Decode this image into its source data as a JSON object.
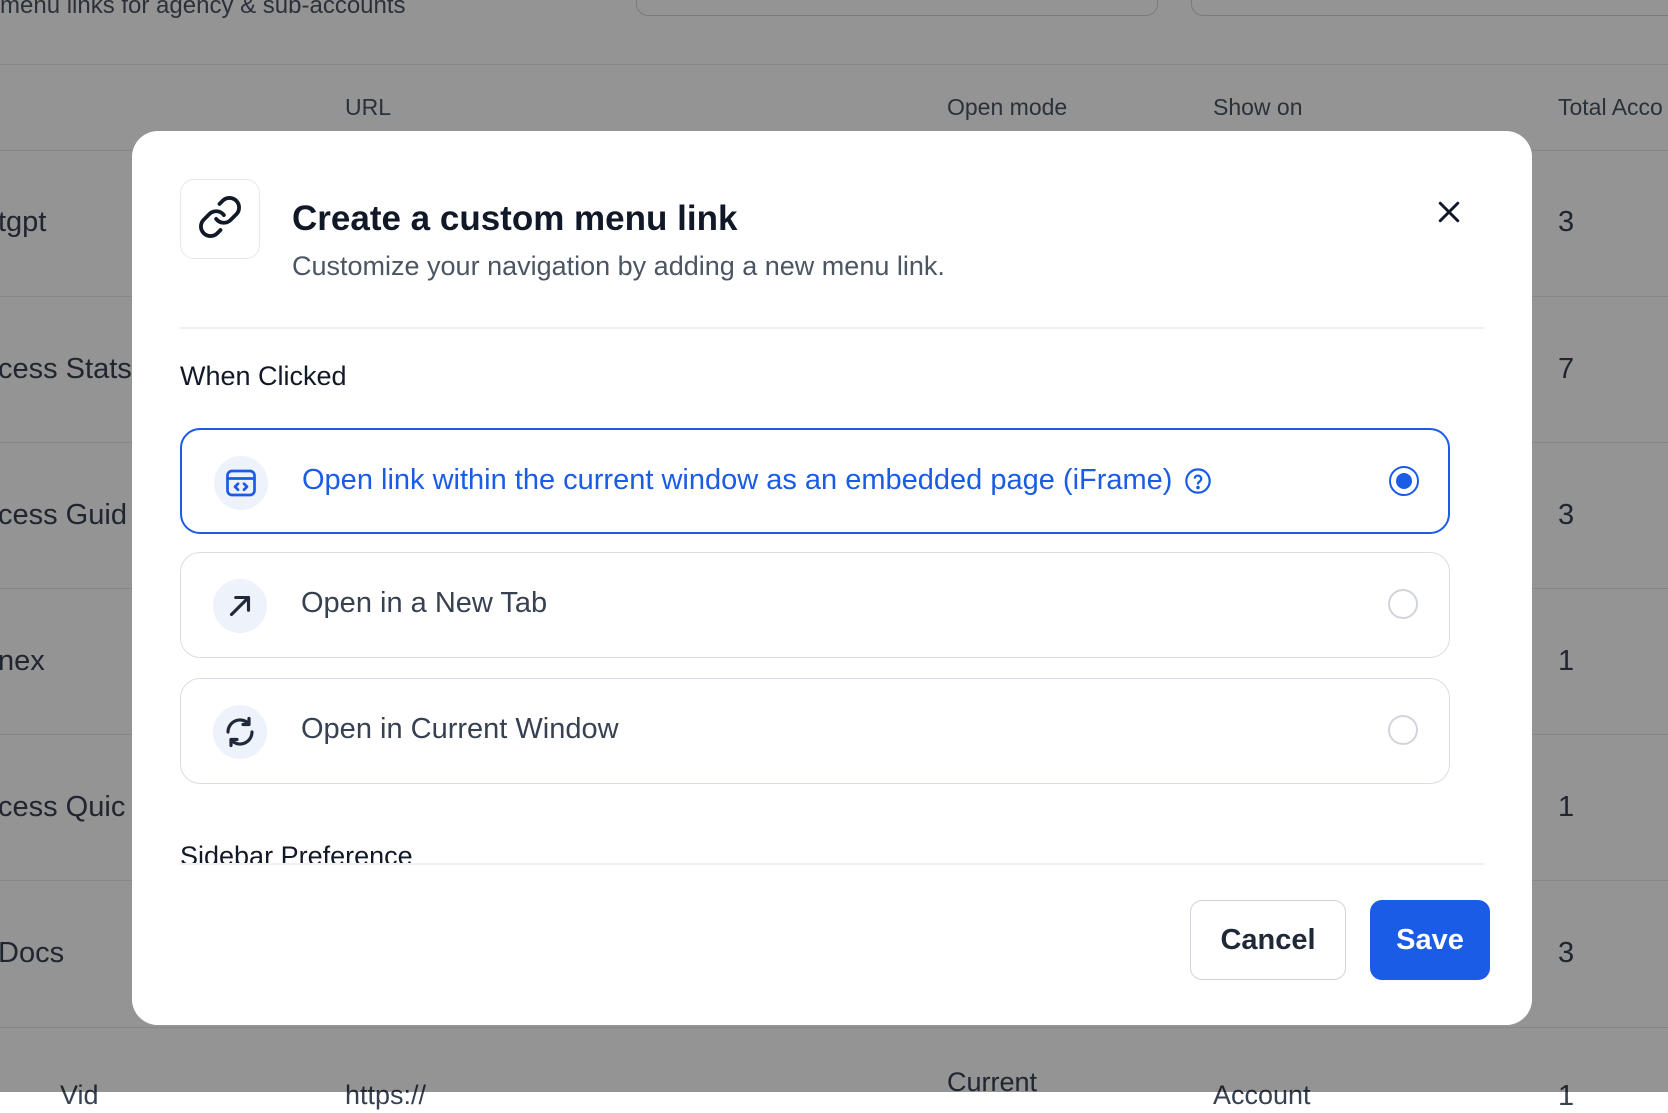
{
  "background": {
    "subtitle": "menu links for agency & sub-accounts",
    "columns": [
      "URL",
      "Open mode",
      "Show on",
      "Total Acco"
    ],
    "rows": [
      {
        "name": "tgpt",
        "count": "3"
      },
      {
        "name": "cess Stats",
        "count": "7"
      },
      {
        "name": "cess Guid",
        "count": "3"
      },
      {
        "name": "nex",
        "count": "1"
      },
      {
        "name": "cess Quic",
        "count": "1"
      },
      {
        "name": "Docs",
        "count": "3"
      }
    ],
    "partial_row": {
      "name": "Vid",
      "url": "https://",
      "open_mode": "Current",
      "show_on": "Account",
      "count": "1"
    }
  },
  "modal": {
    "title": "Create a custom menu link",
    "description": "Customize your navigation by adding a new menu link.",
    "when_clicked_label": "When Clicked",
    "options": [
      {
        "label": "Open link within the current window as an embedded page (iFrame)",
        "icon": "iframe-embed-icon",
        "selected": true
      },
      {
        "label": "Open in a New Tab",
        "icon": "arrow-up-right-icon",
        "selected": false
      },
      {
        "label": "Open in Current Window",
        "icon": "refresh-icon",
        "selected": false
      }
    ],
    "sidebar_preference_label": "Sidebar Preference",
    "cancel_label": "Cancel",
    "save_label": "Save"
  },
  "colors": {
    "accent": "#1a5ce6",
    "overlay": "rgba(0,0,0,0.42)",
    "icon_bg": "#eef2fb"
  }
}
